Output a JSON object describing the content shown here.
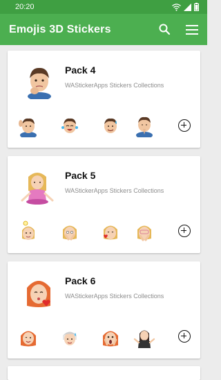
{
  "status_bar": {
    "time": "20:20"
  },
  "app_bar": {
    "title": "Emojis 3D Stickers",
    "icons": [
      "search-icon",
      "menu-icon"
    ]
  },
  "colors": {
    "primary": "#4caf50",
    "status_bar": "#3f9f42",
    "background": "#ececec",
    "card": "#ffffff",
    "publisher_text": "#8c8c8c"
  },
  "packs": [
    {
      "name": "Pack 4",
      "publisher": "WAStickerApps Stickers Collections",
      "sticker_count_visible": 4
    },
    {
      "name": "Pack 5",
      "publisher": "WAStickerApps Stickers Collections",
      "sticker_count_visible": 4
    },
    {
      "name": "Pack 6",
      "publisher": "WAStickerApps Stickers Collections",
      "sticker_count_visible": 4
    }
  ]
}
